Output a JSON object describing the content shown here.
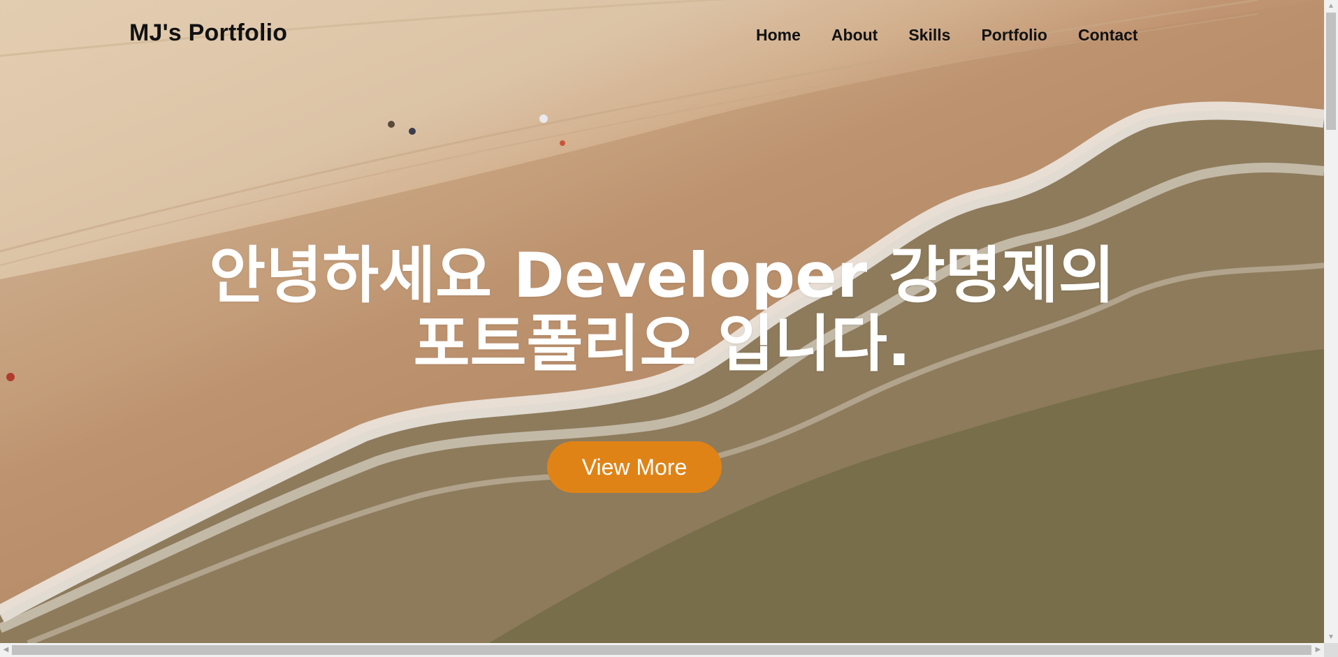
{
  "header": {
    "logo": "MJ's Portfolio",
    "nav": [
      "Home",
      "About",
      "Skills",
      "Portfolio",
      "Contact"
    ]
  },
  "hero": {
    "headline_line1": "안녕하세요 Developer 강명제의",
    "headline_line2": "포트폴리오 입니다.",
    "cta_label": "View More",
    "background": "beach-aerial-video"
  },
  "colors": {
    "cta": "#e08316",
    "text_dark": "#111111",
    "headline": "#ffffff"
  },
  "icons": {
    "scroll_up": "▲",
    "scroll_down": "▼",
    "scroll_left": "◀",
    "scroll_right": "▶"
  }
}
